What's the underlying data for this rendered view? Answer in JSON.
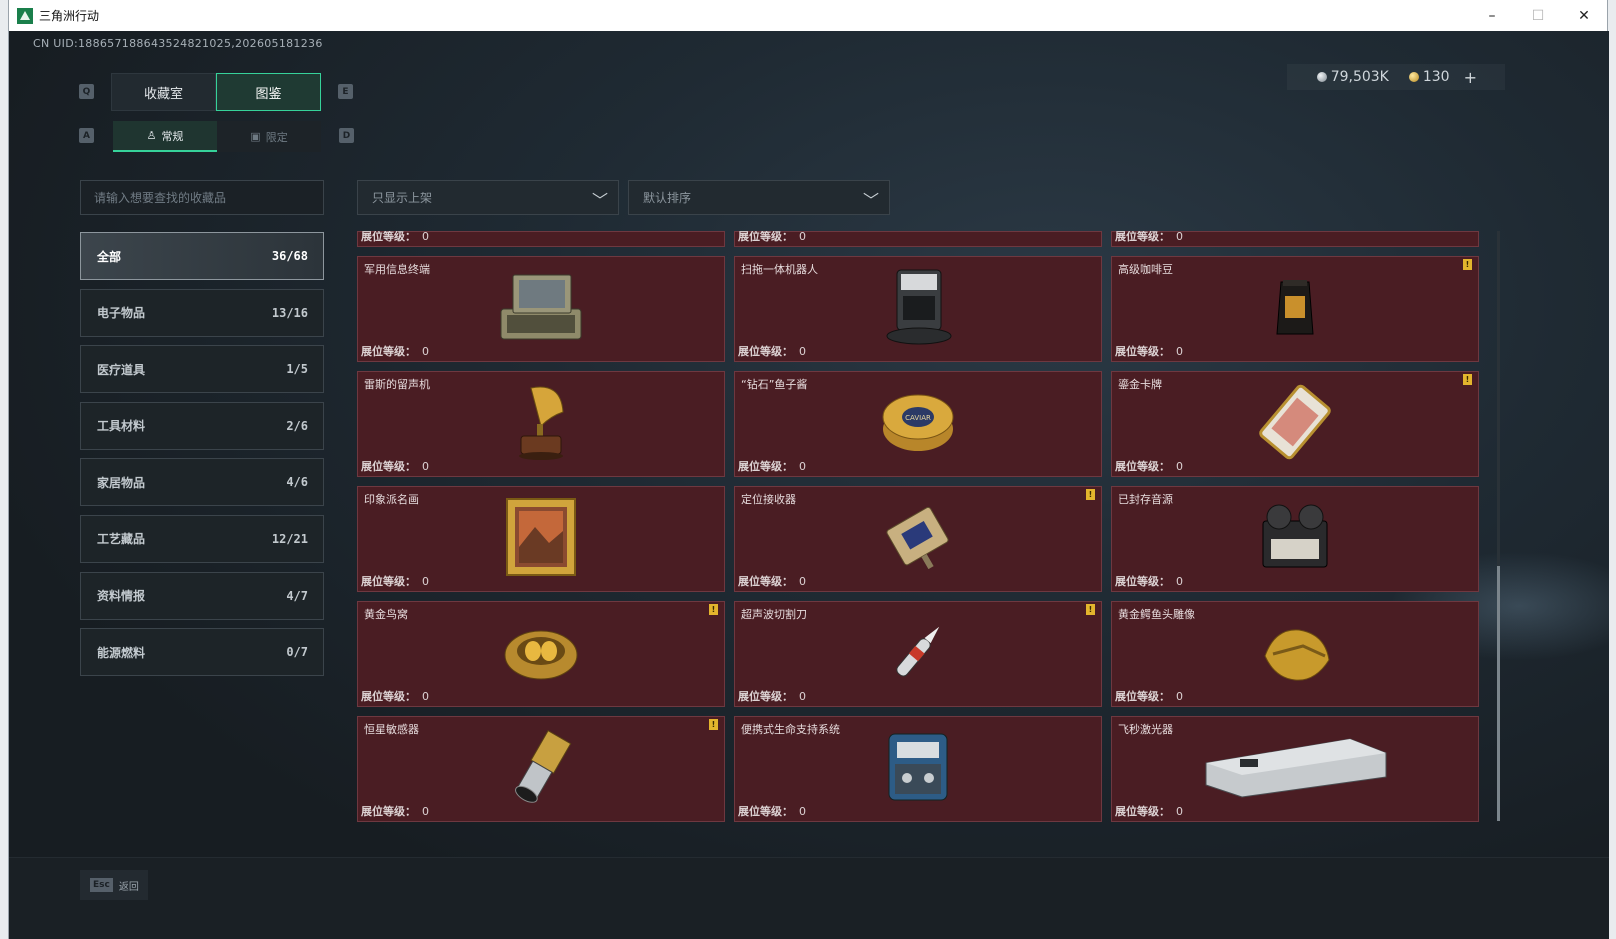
{
  "window": {
    "title": "三角洲行动",
    "minimize": "–",
    "maximize": "☐",
    "close": "✕"
  },
  "uid": "CN UID:1886571886435248210​25,202605181236",
  "currency": {
    "silver": "79,503K",
    "gold": "130",
    "add": "+"
  },
  "keys": {
    "q": "Q",
    "e": "E",
    "a": "A",
    "d": "D"
  },
  "tabs": [
    {
      "label": "收藏室"
    },
    {
      "label": "图鉴"
    }
  ],
  "subtabs": [
    {
      "label": "常规"
    },
    {
      "label": "限定"
    }
  ],
  "search": {
    "placeholder": "请输入想要查找的收藏品"
  },
  "filters": {
    "shelf": "只显示上架",
    "sort": "默认排序"
  },
  "categories": [
    {
      "label": "全部",
      "count": "36/68"
    },
    {
      "label": "电子物品",
      "count": "13/16"
    },
    {
      "label": "医疗道具",
      "count": "1/5"
    },
    {
      "label": "工具材料",
      "count": "2/6"
    },
    {
      "label": "家居物品",
      "count": "4/6"
    },
    {
      "label": "工艺藏品",
      "count": "12/21"
    },
    {
      "label": "资料情报",
      "count": "4/7"
    },
    {
      "label": "能源燃料",
      "count": "0/7"
    }
  ],
  "level_label": "展位等级：",
  "partial_row": [
    {
      "level": "0"
    },
    {
      "level": "0"
    },
    {
      "level": "0"
    }
  ],
  "items": [
    {
      "name": "军用信息终端",
      "level": "0",
      "flag": false,
      "icon": "terminal-icon"
    },
    {
      "name": "扫拖一体机器人",
      "level": "0",
      "flag": false,
      "icon": "robot-vacuum-icon"
    },
    {
      "name": "高级咖啡豆",
      "level": "0",
      "flag": true,
      "icon": "coffee-bag-icon"
    },
    {
      "name": "雷斯的留声机",
      "level": "0",
      "flag": false,
      "icon": "gramophone-icon"
    },
    {
      "name": "“钻石”鱼子酱",
      "level": "0",
      "flag": false,
      "icon": "caviar-tin-icon",
      "icon_text": "CAVIAR"
    },
    {
      "name": "鎏金卡牌",
      "level": "0",
      "flag": true,
      "icon": "gilded-card-icon"
    },
    {
      "name": "印象派名画",
      "level": "0",
      "flag": false,
      "icon": "painting-icon"
    },
    {
      "name": "定位接收器",
      "level": "0",
      "flag": true,
      "icon": "gps-receiver-icon"
    },
    {
      "name": "已封存音源",
      "level": "0",
      "flag": false,
      "icon": "tape-recorder-icon"
    },
    {
      "name": "黄金鸟窝",
      "level": "0",
      "flag": true,
      "icon": "golden-nest-icon"
    },
    {
      "name": "超声波切割刀",
      "level": "0",
      "flag": true,
      "icon": "ultrasonic-knife-icon"
    },
    {
      "name": "黄金鳄鱼头雕像",
      "level": "0",
      "flag": false,
      "icon": "gold-crocodile-icon"
    },
    {
      "name": "恒星敏感器",
      "level": "0",
      "flag": true,
      "icon": "star-sensor-icon"
    },
    {
      "name": "便携式生命支持系统",
      "level": "0",
      "flag": false,
      "icon": "life-support-icon"
    },
    {
      "name": "飞秒激光器",
      "level": "0",
      "flag": false,
      "icon": "femto-laser-icon"
    }
  ],
  "flag_mark": "!",
  "footer": {
    "esc": "Esc",
    "back": "返回"
  },
  "colors": {
    "accent": "#36d29a",
    "card_bg": "#4a1d23",
    "flag": "#e3b52d"
  }
}
